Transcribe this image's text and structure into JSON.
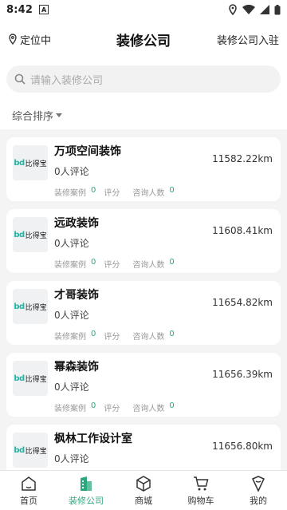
{
  "status": {
    "time": "8:42",
    "badge": "A"
  },
  "header": {
    "location": "定位中",
    "title": "装修公司",
    "join": "装修公司入驻"
  },
  "search": {
    "placeholder": "请输入装修公司"
  },
  "sort": {
    "label": "综合排序"
  },
  "brand": {
    "logo_text_1": "bd",
    "logo_text_2": "比得宝"
  },
  "stats_labels": {
    "cases": "装修案例",
    "rating": "评分",
    "consult": "咨询人数"
  },
  "companies": [
    {
      "name": "万项空间装饰",
      "reviews": "0人评论",
      "cases": "0",
      "rating": "",
      "consult": "0",
      "distance": "11582.22km"
    },
    {
      "name": "远政装饰",
      "reviews": "0人评论",
      "cases": "0",
      "rating": "",
      "consult": "0",
      "distance": "11608.41km"
    },
    {
      "name": "才哥装饰",
      "reviews": "0人评论",
      "cases": "0",
      "rating": "",
      "consult": "0",
      "distance": "11654.82km"
    },
    {
      "name": "幂森装饰",
      "reviews": "0人评论",
      "cases": "0",
      "rating": "",
      "consult": "0",
      "distance": "11656.39km"
    },
    {
      "name": "枫林工作设计室",
      "reviews": "0人评论",
      "cases": "",
      "rating": "",
      "consult": "",
      "distance": "11656.80km"
    }
  ],
  "tabs": [
    {
      "label": "首页",
      "icon": "home-icon"
    },
    {
      "label": "装修公司",
      "icon": "building-icon",
      "active": true
    },
    {
      "label": "商城",
      "icon": "box-icon"
    },
    {
      "label": "购物车",
      "icon": "cart-icon"
    },
    {
      "label": "我的",
      "icon": "user-icon"
    }
  ],
  "colors": {
    "accent": "#2ca87f",
    "logo": "#1db5a6"
  }
}
